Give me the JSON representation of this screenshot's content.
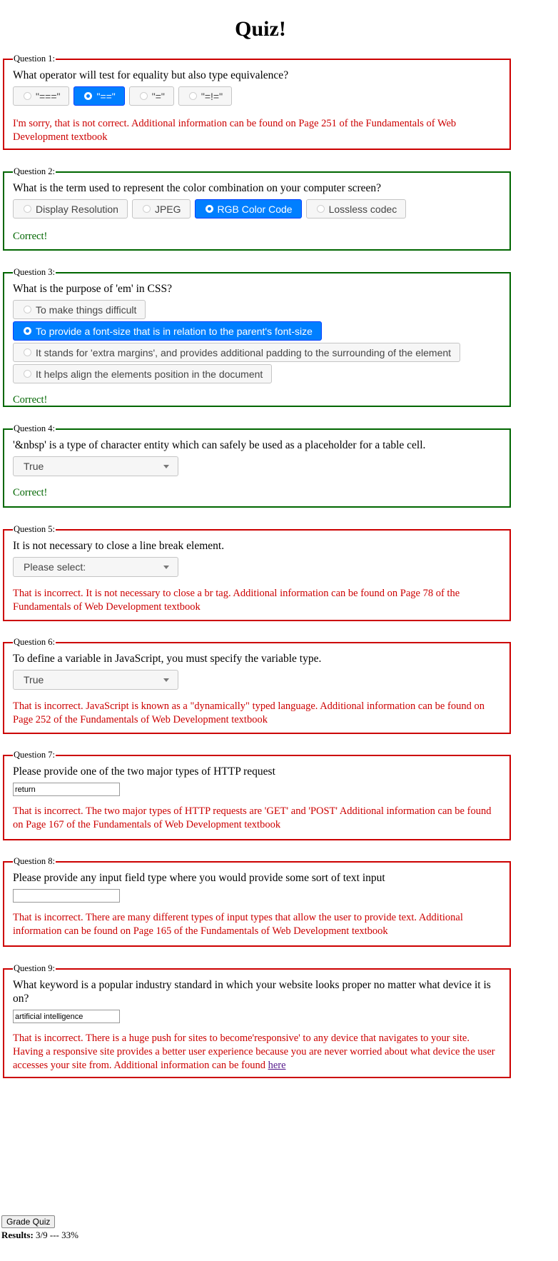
{
  "page": {
    "title": "Quiz!"
  },
  "questions": [
    {
      "legend": "Question 1:",
      "text": "What operator will test for equality but also type equivalence?",
      "choices": [
        "\"===\"",
        "\"==\"",
        "\"=\"",
        "\"=!=\""
      ],
      "selected_index": 1,
      "feedback": "I'm sorry, that is not correct. Additional information can be found on Page 251 of the Fundamentals of Web Development textbook"
    },
    {
      "legend": "Question 2:",
      "text": "What is the term used to represent the color combination on your computer screen?",
      "choices": [
        "Display Resolution",
        "JPEG",
        "RGB Color Code",
        "Lossless codec"
      ],
      "selected_index": 2,
      "feedback": "Correct!"
    },
    {
      "legend": "Question 3:",
      "text": "What is the purpose of 'em' in CSS?",
      "choices": [
        "To make things difficult",
        "To provide a font-size that is in relation to the parent's font-size",
        "It stands for 'extra margins', and provides additional padding to the surrounding of the element",
        "It helps align the elements position in the document"
      ],
      "selected_index": 1,
      "feedback": "Correct!"
    },
    {
      "legend": "Question 4:",
      "text": "'&nbsp' is a type of character entity which can safely be used as a placeholder for a table cell.",
      "select_value": "True",
      "feedback": "Correct!"
    },
    {
      "legend": "Question 5:",
      "text": "It is not necessary to close a line break element.",
      "select_value": "Please select:",
      "feedback": "That is incorrect. It is not necessary to close a br tag. Additional information can be found on Page 78 of the Fundamentals of Web Development textbook"
    },
    {
      "legend": "Question 6:",
      "text": "To define a variable in JavaScript, you must specify the variable type.",
      "select_value": "True",
      "feedback": "That is incorrect. JavaScript is known as a \"dynamically\" typed language. Additional information can be found on Page 252 of the Fundamentals of Web Development textbook"
    },
    {
      "legend": "Question 7:",
      "text": "Please provide one of the two major types of HTTP request",
      "input_value": "return",
      "feedback": "That is incorrect. The two major types of HTTP requests are 'GET' and 'POST' Additional information can be found on Page 167 of the Fundamentals of Web Development textbook"
    },
    {
      "legend": "Question 8:",
      "text": "Please provide any input field type where you would provide some sort of text input",
      "input_value": "",
      "feedback": "That is incorrect. There are many different types of input types that allow the user to provide text. Additional information can be found on Page 165 of the Fundamentals of Web Development textbook"
    },
    {
      "legend": "Question 9:",
      "text": "What keyword is a popular industry standard in which your website looks proper no matter what device it is on?",
      "input_value": "artificial intelligence",
      "feedback": "That is incorrect. There is a huge push for sites to become'responsive' to any device that navigates to your site. Having a responsive site provides a better user experience because you are never worried about what device the user accesses your site from. Additional information can be found",
      "feedback_link": "here"
    }
  ],
  "footer": {
    "grade_label": "Grade Quiz",
    "results_label": "Results:",
    "results_value": "3/9 --- 33%"
  },
  "colors": {
    "incorrect": "#cc0000",
    "correct": "#006600",
    "selected": "#007fff"
  }
}
